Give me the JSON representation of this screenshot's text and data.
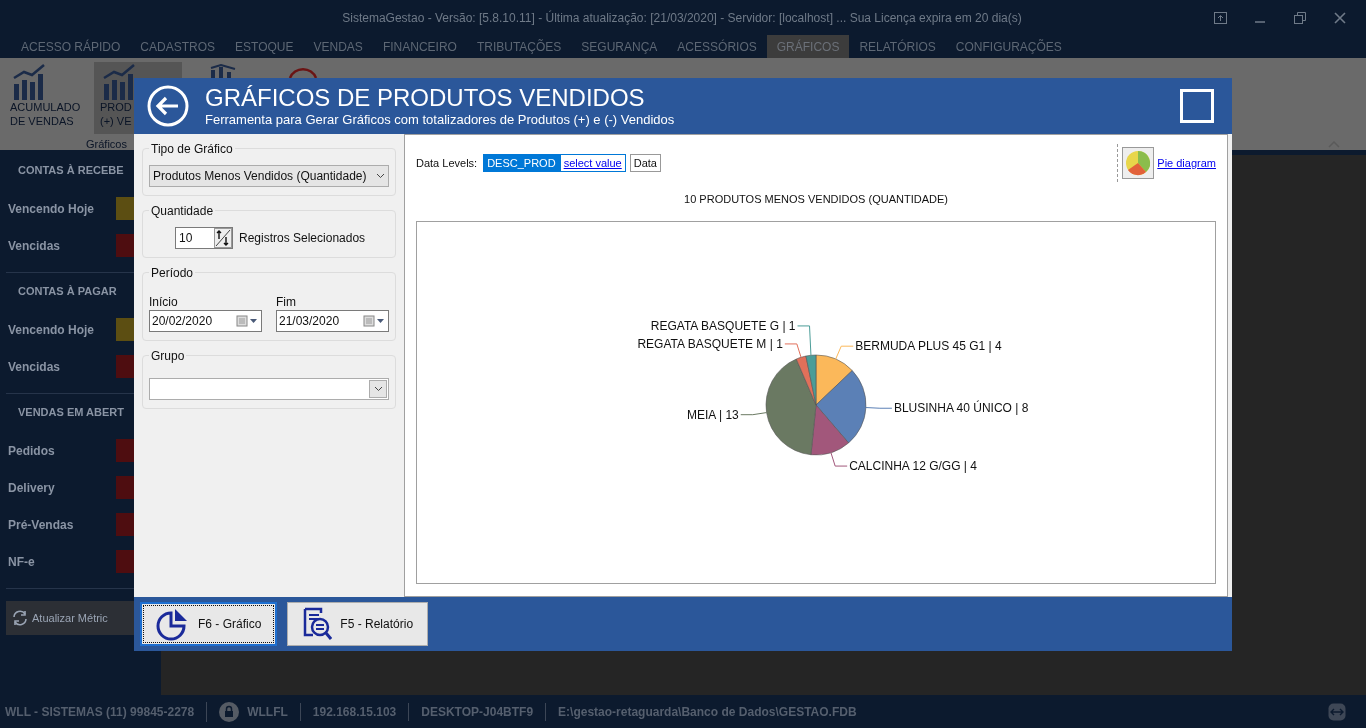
{
  "title_bar": {
    "title": "SistemaGestao - Versão: [5.8.10.11] - Última atualização: [21/03/2020] - Servidor: [localhost] ... Sua Licença expira em 20 dia(s)"
  },
  "menu_tabs": [
    {
      "label": "ACESSO RÁPIDO",
      "selected": false
    },
    {
      "label": "CADASTROS",
      "selected": false
    },
    {
      "label": "ESTOQUE",
      "selected": false
    },
    {
      "label": "VENDAS",
      "selected": false
    },
    {
      "label": "FINANCEIRO",
      "selected": false
    },
    {
      "label": "TRIBUTAÇÕES",
      "selected": false
    },
    {
      "label": "SEGURANÇA",
      "selected": false
    },
    {
      "label": "ACESSÓRIOS",
      "selected": false
    },
    {
      "label": "GRÁFICOS",
      "selected": true
    },
    {
      "label": "RELATÓRIOS",
      "selected": false
    },
    {
      "label": "CONFIGURAÇÕES",
      "selected": false
    }
  ],
  "ribbon": {
    "group_label": "Gráficos",
    "buttons": [
      {
        "kind": "bars",
        "lines": [
          "ACUMULADO",
          "DE VENDAS"
        ],
        "selected": false
      },
      {
        "kind": "bars",
        "lines": [
          "PROD",
          "(+) VE"
        ],
        "selected": true
      },
      {
        "kind": "scatter",
        "selected": false
      },
      {
        "kind": "ring",
        "selected": false
      }
    ]
  },
  "sidebar": {
    "sections": [
      {
        "heading": "CONTAS À RECEBE",
        "items": [
          {
            "label": "Vencendo Hoje",
            "color": "#5c4e12"
          },
          {
            "label": "Vencidas",
            "color": "#4e0d10"
          }
        ]
      },
      {
        "heading": "CONTAS À PAGAR",
        "items": [
          {
            "label": "Vencendo Hoje",
            "color": "#5c4e12"
          },
          {
            "label": "Vencidas",
            "color": "#4e0d10"
          }
        ]
      },
      {
        "heading": "VENDAS EM ABERT",
        "items": [
          {
            "label": "Pedidos",
            "color": "#4e0d10"
          },
          {
            "label": "Delivery",
            "color": "#4e0d10"
          },
          {
            "label": "Pré-Vendas",
            "color": "#4e0d10"
          },
          {
            "label": "NF-e",
            "color": "#4e0d10"
          }
        ]
      }
    ],
    "refresh_button": "Atualizar Métric"
  },
  "dialog": {
    "title": "GRÁFICOS DE PRODUTOS VENDIDOS",
    "subtitle": "Ferramenta para Gerar Gráficos com totalizadores de Produtos (+) e (-) Vendidos",
    "tipo": {
      "legend": "Tipo de Gráfico",
      "value": "Produtos Menos Vendidos (Quantidade)"
    },
    "quantidade": {
      "legend": "Quantidade",
      "value": "10",
      "suffix": "Registros Selecionados"
    },
    "periodo": {
      "legend": "Período",
      "inicio": {
        "label": "Início",
        "value": "20/02/2020"
      },
      "fim": {
        "label": "Fim",
        "value": "21/03/2020"
      }
    },
    "grupo": {
      "legend": "Grupo"
    },
    "data_levels": {
      "label": "Data Levels:",
      "levels": [
        {
          "kind": "link",
          "text": "select value"
        },
        {
          "kind": "box",
          "text": "Data"
        }
      ]
    },
    "view_button": {
      "label": "Pie diagram"
    },
    "chart_data": {
      "type": "pie",
      "title": "10 PRODUTOS MENOS VENDIDOS (QUANTIDADE)",
      "categories": [
        "BERMUDA PLUS 45 G1 | 4",
        "BLUSINHA 40 ÚNICO | 8",
        "CALCINHA 12 G/GG | 4",
        "MEIA | 13",
        "REGATA BASQUETE M | 1",
        "REGATA BASQUETE G | 1"
      ],
      "series": [
        {
          "name": "DESC_PROD",
          "values": [
            4,
            8,
            4,
            13,
            1,
            1
          ]
        }
      ]
    },
    "footer_buttons": [
      {
        "kind": "chart",
        "label": "F6 - Gráfico",
        "focused": true
      },
      {
        "kind": "report",
        "label": "F5 - Relatório",
        "focused": false
      }
    ]
  },
  "status_bar": {
    "items": [
      {
        "kind": "text",
        "text": "WLL - SISTEMAS (11) 99845-2278"
      },
      {
        "kind": "user",
        "text": "WLLFL"
      },
      {
        "kind": "text",
        "text": "192.168.15.103"
      },
      {
        "kind": "text",
        "text": "DESKTOP-J04BTF9"
      },
      {
        "kind": "text",
        "text": "E:\\gestao-retaguarda\\Banco de Dados\\GESTAO.FDB"
      }
    ]
  }
}
